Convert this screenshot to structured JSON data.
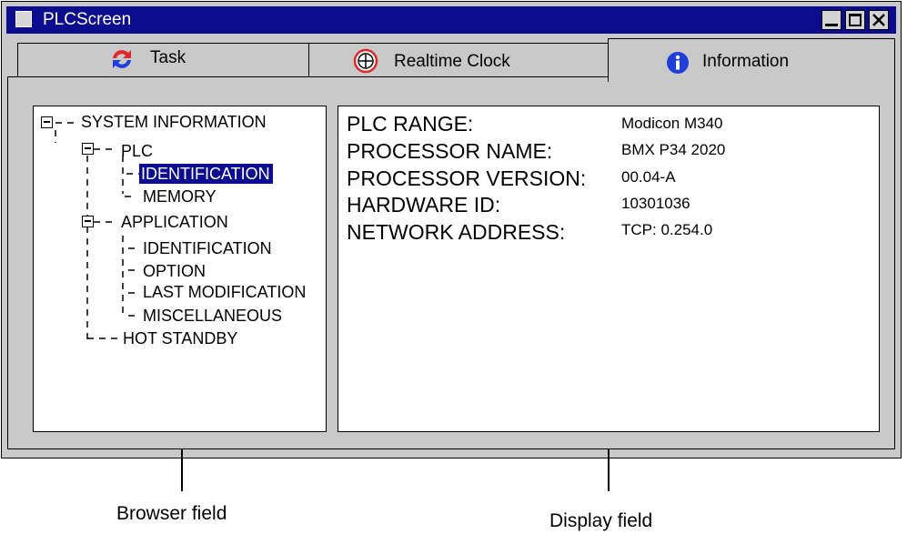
{
  "window": {
    "title": "PLCScreen"
  },
  "tabs": [
    {
      "label": "Task",
      "icon": "sync-arrows-icon",
      "active": false
    },
    {
      "label": "Realtime Clock",
      "icon": "clock-icon",
      "active": false
    },
    {
      "label": "Information",
      "icon": "info-icon",
      "active": true
    }
  ],
  "browser": {
    "root": "SYSTEM INFORMATION",
    "plc": {
      "label": "PLC",
      "children": [
        "IDENTIFICATION",
        "MEMORY"
      ]
    },
    "application": {
      "label": "APPLICATION",
      "children": [
        "IDENTIFICATION",
        "OPTION",
        "LAST MODIFICATION",
        "MISCELLANEOUS"
      ]
    },
    "hot_standby": "HOT STANDBY",
    "selected": "PLC > IDENTIFICATION"
  },
  "display": {
    "rows": [
      {
        "label": "PLC RANGE:",
        "value": "Modicon M340"
      },
      {
        "label": "PROCESSOR NAME:",
        "value": "BMX P34 2020"
      },
      {
        "label": "PROCESSOR VERSION:",
        "value": "00.04-A"
      },
      {
        "label": "HARDWARE ID:",
        "value": "10301036"
      },
      {
        "label": "NETWORK ADDRESS:",
        "value": "TCP: 0.254.0"
      }
    ]
  },
  "captions": {
    "browser": "Browser field",
    "display": "Display field"
  },
  "colors": {
    "titlebar": "#0c0c8e",
    "window": "#c9c9c9",
    "selection": "#0c0c8e",
    "task_icon_red": "#e0282a",
    "task_icon_blue": "#1f3fd8",
    "clock_icon_red": "#e0282a",
    "info_icon_blue": "#1f3fd8"
  }
}
